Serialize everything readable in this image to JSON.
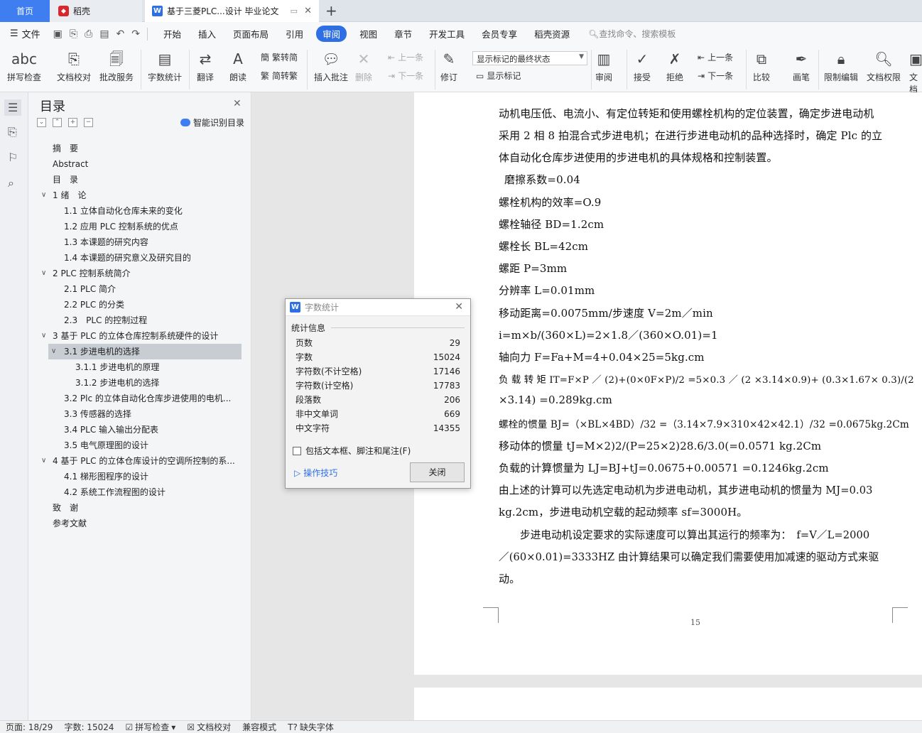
{
  "tabs": {
    "home": "首页",
    "daoke": "稻壳",
    "doc": "基于三菱PLC...设计 毕业论文"
  },
  "menu": {
    "file": "文件",
    "items": [
      "开始",
      "插入",
      "页面布局",
      "引用",
      "审阅",
      "视图",
      "章节",
      "开发工具",
      "会员专享",
      "稻壳资源"
    ],
    "active": "审阅",
    "search": "查找命令、搜索模板"
  },
  "ribbon": {
    "spell": "拼写检查",
    "doccheck": "文档校对",
    "batch": "批改服务",
    "wordcount": "字数统计",
    "translate": "翻译",
    "read": "朗读",
    "t2s": "繁转简",
    "s2t": "简转繁",
    "insert_comment": "插入批注",
    "delete": "删除",
    "prev": "上一条",
    "next": "下一条",
    "revise": "修订",
    "show_select": "显示标记的最终状态",
    "show_marks": "显示标记",
    "review": "审阅",
    "accept": "接受",
    "reject": "拒绝",
    "prev2": "上一条",
    "next2": "下一条",
    "compare": "比较",
    "pen": "画笔",
    "restrict": "限制编辑",
    "rights": "文档权限",
    "docx": "文档"
  },
  "toc": {
    "title": "目录",
    "smart": "智能识别目录",
    "items": [
      "摘　要",
      "Abstract",
      "目　录",
      "1 绪　论",
      "1.1 立体自动化仓库未来的变化",
      "1.2 应用 PLC 控制系统的优点",
      "1.3 本课题的研究内容",
      "1.4 本课题的研究意义及研究目的",
      "2 PLC 控制系统简介",
      "2.1 PLC 简介",
      "2.2 PLC 的分类",
      "2.3　PLC 的控制过程",
      "3 基于 PLC 的立体仓库控制系统硬件的设计",
      "3.1 步进电机的选择",
      "3.1.1 步进电机的原理",
      "3.1.2 步进电机的选择",
      "3.2 Plc 的立体自动化仓库步进使用的电机...",
      "3.3 传感器的选择",
      "3.4 PLC 输入输出分配表",
      "3.5 电气原理图的设计",
      "4 基于 PLC 的立体仓库设计的空调所控制的系...",
      "4.1 梯形图程序的设计",
      "4.2 系统工作流程图的设计",
      "致　谢",
      "参考文献"
    ]
  },
  "doc": {
    "lines": [
      "动机电压低、电流小、有定位转矩和使用螺栓机构的定位装置，确定步进电动机",
      "采用 2 相 8 拍混合式步进电机；在进行步进电动机的品种选择时，确定 Plc 的立",
      "体自动化仓库步进使用的步进电机的具体规格和控制装置。",
      "磨擦系数=0.04",
      "螺栓机构的效率=O.9",
      "螺栓轴径 BD=1.2cm",
      "螺栓长 BL=42cm",
      "螺距 P=3mm",
      "分辨率 L=0.01mm",
      "移动距离=0.0075mm/步速度 V=2m／min",
      "i=m×b/(360×L)=2×1.8／(360×O.01)=1",
      "轴向力 F=Fa+M=4+0.04×25=5kg.cm",
      "负 载 转 矩 IT=F×P ／ (2)+(0×0F×P)/2 =5×0.3 ／ (2 ×3.14×0.9)+ (0.3×1.67× 0.3)/(2",
      "×3.14) =0.289kg.cm",
      "螺栓的惯量 BJ=（×BL×4BD）/32 =（3.14×7.9×310×42×42.1）/32 =0.0675kg.2Cm",
      "移动体的惯量 tJ=M×2)2/(P=25×2)28.6/3.0(=0.0571 kg.2Cm",
      "负载的计算惯量为 LJ=BJ+tJ=0.0675+0.00571 =0.1246kg.2cm",
      "由上述的计算可以先选定电动机为步进电动机，其步进电动机的惯量为 MJ=0.03",
      "kg.2cm，步进电动机空载的起动频率 sf=3000H。",
      "步进电动机设定要求的实际速度可以算出其运行的频率为：　f=V／L=2000",
      "／(60×0.01)=3333HZ 由计算结果可以确定我们需要使用加减速的驱动方式来驱",
      "动。"
    ],
    "page_number": "15"
  },
  "dialog": {
    "title": "字数统计",
    "section": "统计信息",
    "rows": [
      {
        "label": "页数",
        "value": "29"
      },
      {
        "label": "字数",
        "value": "15024"
      },
      {
        "label": "字符数(不计空格)",
        "value": "17146"
      },
      {
        "label": "字符数(计空格)",
        "value": "17783"
      },
      {
        "label": "段落数",
        "value": "206"
      },
      {
        "label": "非中文单词",
        "value": "669"
      },
      {
        "label": "中文字符",
        "value": "14355"
      }
    ],
    "checkbox": "包括文本框、脚注和尾注(F)",
    "tips": "操作技巧",
    "close": "关闭"
  },
  "status": {
    "page": "页面: 18/29",
    "words": "字数: 15024",
    "spell": "拼写检查",
    "doccheck": "文档校对",
    "compat": "兼容模式",
    "font": "缺失字体"
  }
}
